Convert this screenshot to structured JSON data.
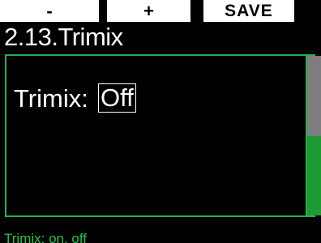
{
  "softkeys": {
    "minus_label": "-",
    "plus_label": "+",
    "save_label": "SAVE"
  },
  "screen": {
    "title": "2.13.Trimix"
  },
  "setting": {
    "label": "Trimix:",
    "value": "Off"
  },
  "scrollbar": {
    "position_fraction": 0.0,
    "visible_fraction": 0.5
  },
  "help": {
    "text": "Trimix: on, off"
  },
  "colors": {
    "accent_green": "#22b44a",
    "background": "#000000",
    "text": "#ffffff",
    "softkey_bg": "#ffffff"
  }
}
